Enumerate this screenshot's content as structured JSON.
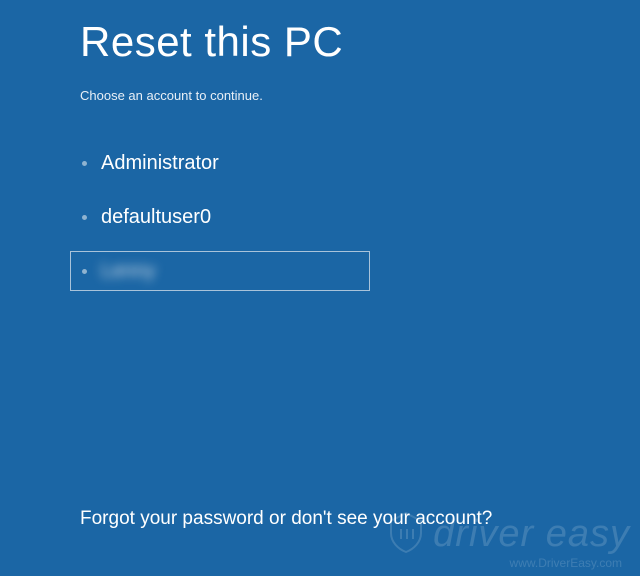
{
  "page": {
    "title": "Reset this PC",
    "subtitle": "Choose an account to continue.",
    "footer_link": "Forgot your password or don't see your account?"
  },
  "accounts": [
    {
      "name": "Administrator",
      "selected": false,
      "blurred": false
    },
    {
      "name": "defaultuser0",
      "selected": false,
      "blurred": false
    },
    {
      "name": "Lenny",
      "selected": true,
      "blurred": true
    }
  ],
  "watermark": {
    "brand": "driver easy",
    "url": "www.DriverEasy.com"
  }
}
